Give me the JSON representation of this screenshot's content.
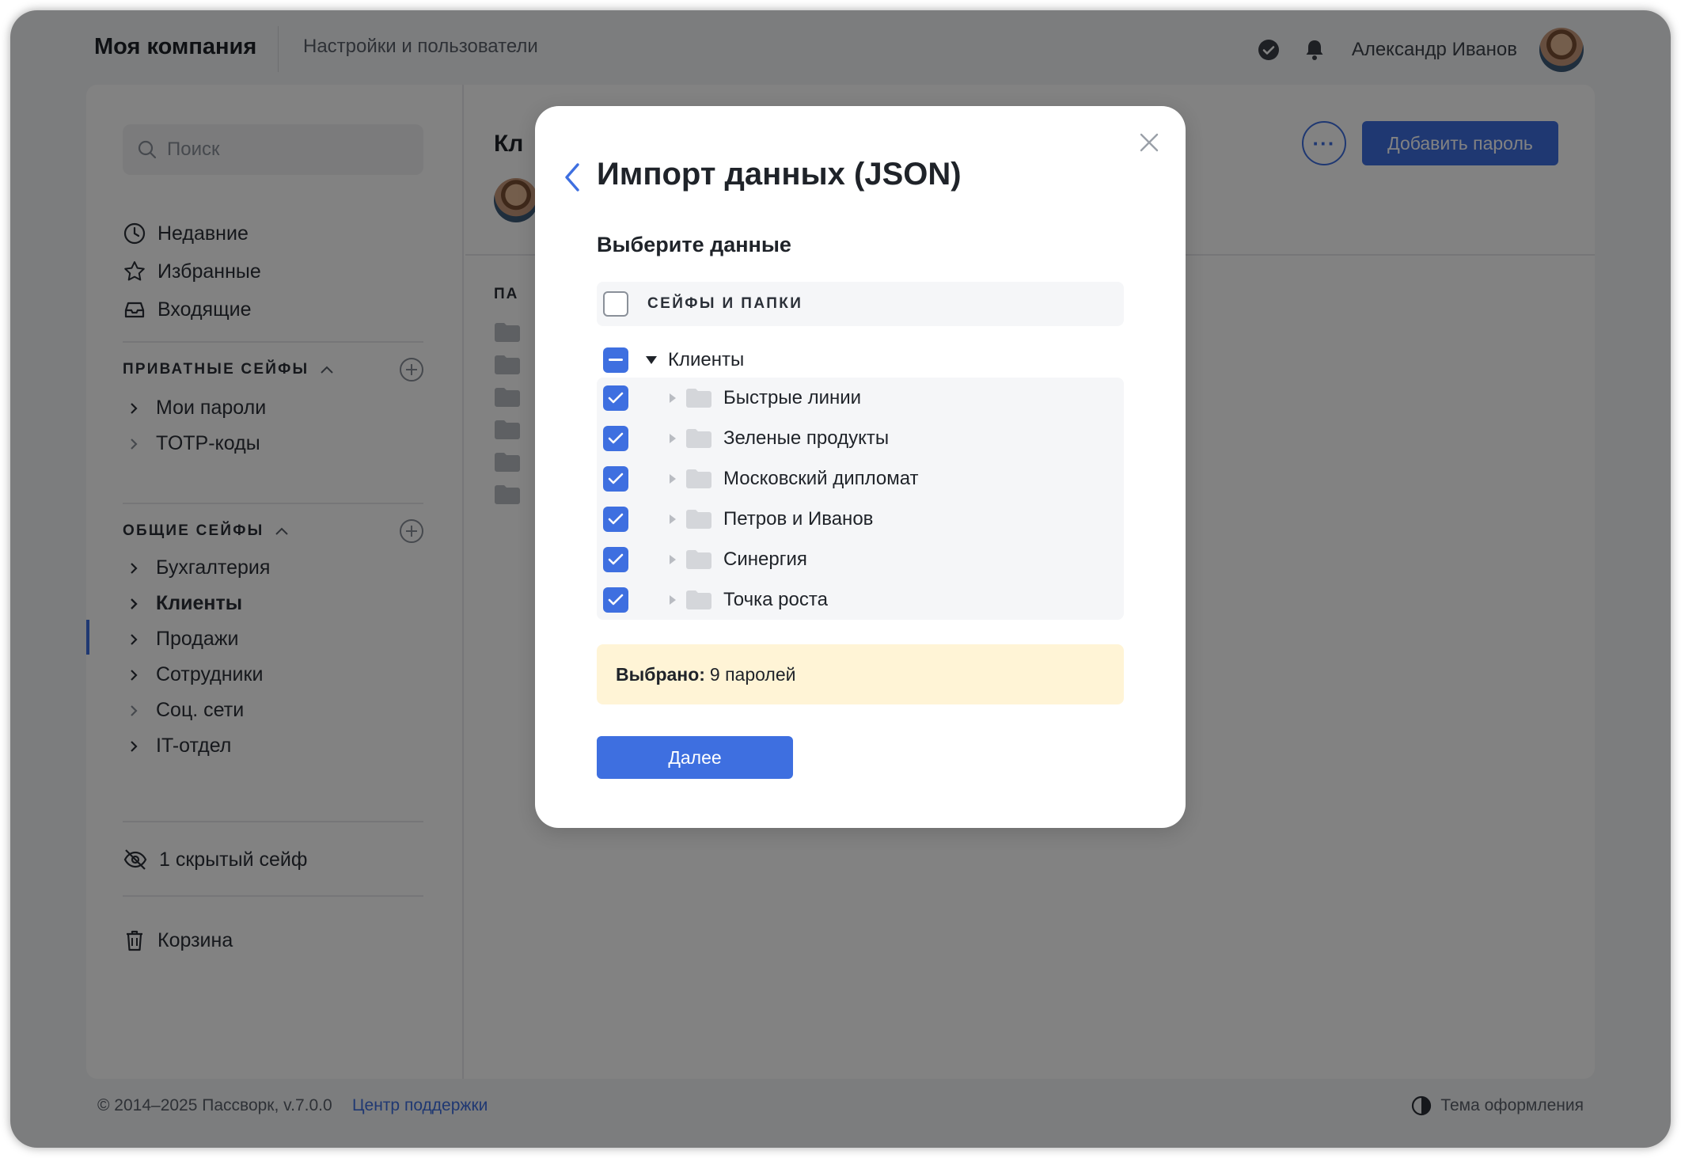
{
  "header": {
    "brand": "Моя компания",
    "section": "Настройки и пользователи",
    "user_name": "Александр Иванов"
  },
  "sidebar": {
    "search_placeholder": "Поиск",
    "nav": [
      {
        "label": "Недавние",
        "icon": "clock-icon"
      },
      {
        "label": "Избранные",
        "icon": "star-icon"
      },
      {
        "label": "Входящие",
        "icon": "inbox-icon"
      }
    ],
    "private_title": "ПРИВАТНЫЕ СЕЙФЫ",
    "private_vaults": [
      "Мои пароли",
      "TOTP-коды"
    ],
    "shared_title": "ОБЩИЕ СЕЙФЫ",
    "shared_vaults": [
      "Бухгалтерия",
      "Клиенты",
      "Продажи",
      "Сотрудники",
      "Соц. сети",
      "IT-отдел"
    ],
    "active_vault": "Клиенты",
    "hidden_vaults": "1 скрытый сейф",
    "trash": "Корзина"
  },
  "content": {
    "title_partial": "Кл",
    "column_partial": "ПА",
    "more_label": "···",
    "add_button": "Добавить пароль"
  },
  "footer": {
    "copyright": "© 2014–2025 Пассворк, v.7.0.0",
    "support": "Центр поддержки",
    "theme": "Тема оформления"
  },
  "modal": {
    "title": "Импорт данных (JSON)",
    "subtitle": "Выберите данные",
    "tree_header": "СЕЙФЫ И ПАПКИ",
    "root": "Клиенты",
    "folders": [
      "Быстрые линии",
      "Зеленые продукты",
      "Московский дипломат",
      "Петров и Иванов",
      "Синергия",
      "Точка роста"
    ],
    "summary_label": "Выбрано:",
    "summary_value": "9 паролей",
    "next_button": "Далее"
  },
  "colors": {
    "accent": "#3e6fe0",
    "summary_bg": "#fff4d6"
  }
}
